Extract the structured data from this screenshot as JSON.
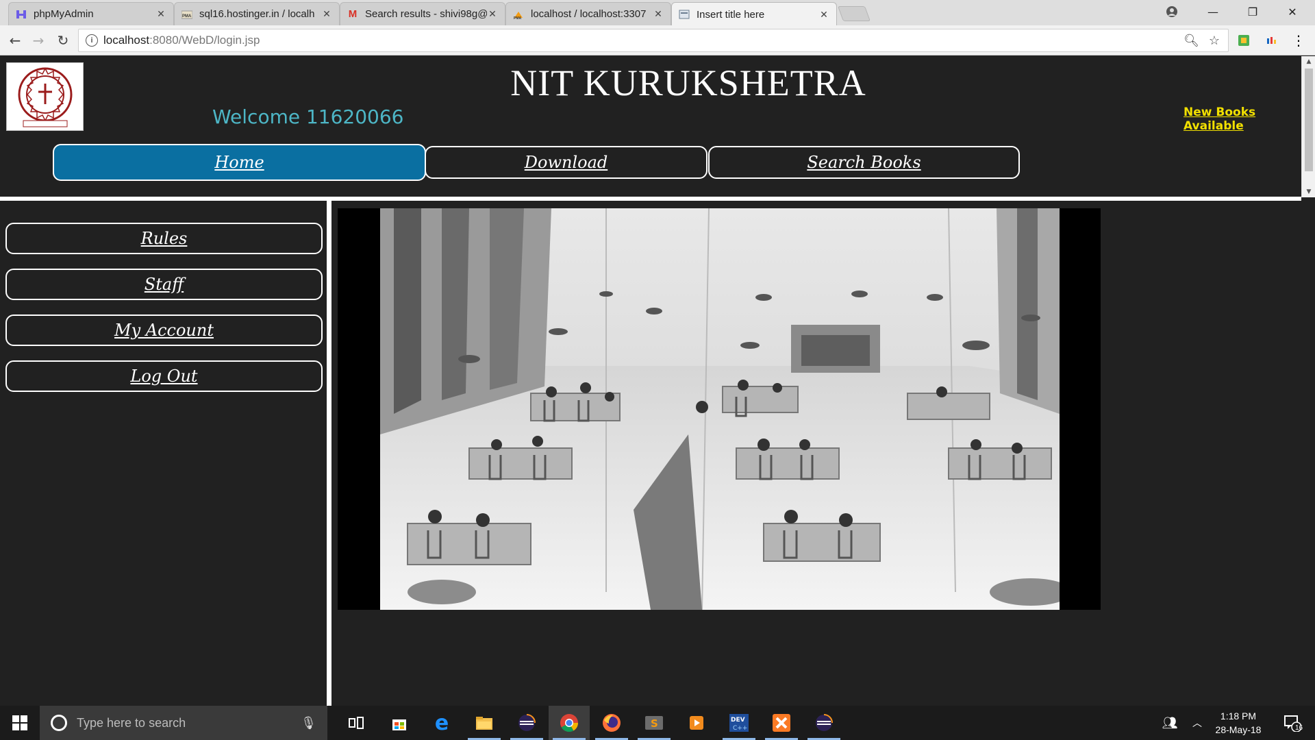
{
  "browser": {
    "tabs": [
      {
        "title": "phpMyAdmin",
        "icon": "phpmyadmin-icon"
      },
      {
        "title": "sql16.hostinger.in / localh",
        "icon": "pma-icon"
      },
      {
        "title": "Search results - shivi98g@",
        "icon": "gmail-icon"
      },
      {
        "title": "localhost / localhost:3307",
        "icon": "pma-icon"
      },
      {
        "title": "Insert title here",
        "icon": "page-icon"
      }
    ],
    "url_host": "localhost",
    "url_path": ":8080/WebD/login.jsp"
  },
  "page": {
    "title": "NIT KURUKSHETRA",
    "welcome": "Welcome 11620066",
    "new_books_link": "New Books Available",
    "top_nav": [
      {
        "label": "Home",
        "active": true
      },
      {
        "label": "Download",
        "active": false
      },
      {
        "label": "Search Books",
        "active": false
      }
    ],
    "side_nav": [
      {
        "label": "Rules"
      },
      {
        "label": "Staff"
      },
      {
        "label": "My Account"
      },
      {
        "label": "Log Out"
      }
    ],
    "colors": {
      "background": "#212121",
      "active_nav": "#0a6fa1",
      "welcome_text": "#4db6c6",
      "new_books_text": "#f2e000"
    }
  },
  "taskbar": {
    "search_placeholder": "Type here to search",
    "apps": [
      "task-view-icon",
      "store-icon",
      "edge-icon",
      "file-explorer-icon",
      "eclipse-icon",
      "chrome-icon",
      "firefox-icon",
      "sublime-text-icon",
      "media-player-icon",
      "devcpp-icon",
      "xampp-icon",
      "eclipse-icon"
    ],
    "time": "1:18 PM",
    "date": "28-May-18",
    "notification_count": "16"
  }
}
